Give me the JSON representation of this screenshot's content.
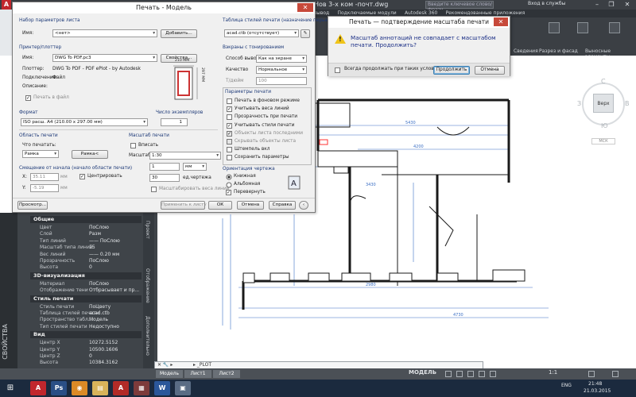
{
  "acad": {
    "title": "Нов 3-х ком -почт.dwg",
    "search_placeholder": "Введите ключевое слово/фразу",
    "login": "Вход в службы",
    "logo": "A",
    "ribbon_tabs": [
      "Вывод",
      "Подключаемые модули",
      "Autodesk 360",
      "Рекомендованные приложения"
    ],
    "ribbon_labels": [
      "Сведения",
      "Разрез и фасад",
      "Выносные элементы"
    ],
    "viewcube": {
      "face": "Верх",
      "n": "С",
      "s": "Ю",
      "w": "З",
      "e": "В",
      "mck": "МСК"
    },
    "window_controls": [
      "–",
      "❐",
      "✕"
    ]
  },
  "plot_dialog": {
    "title": "Печать - Модель",
    "close": "✕",
    "page_setup": {
      "group": "Набор параметров листа",
      "name_label": "Имя:",
      "name_value": "<нет>",
      "add_button": "Добавить..."
    },
    "printer": {
      "group": "Принтер/плоттер",
      "name_label": "Имя:",
      "name_value": "DWG To PDF.pc3",
      "props_button": "Свойства...",
      "plotter_label": "Плоттер:",
      "plotter_value": "DWG To PDF - PDF ePlot - by Autodesk",
      "where_label": "Подключение:",
      "where_value": "Файл",
      "desc_label": "Описание:",
      "plot_to_file": "Печать в файл",
      "preview_width": "210 MM",
      "preview_height": "297 MM"
    },
    "paper": {
      "group": "Формат",
      "value": "ISO расш. A4 (210.00 x 297.00 мм)"
    },
    "copies": {
      "group": "Число экземпляров",
      "value": "1"
    },
    "area": {
      "group": "Область печати",
      "what_label": "Что печатать:",
      "what_value": "Рамка",
      "frame_button": "Рамка<"
    },
    "offset": {
      "group": "Смещение от начала (начало области печати)",
      "x_label": "X:",
      "x_value": "35.11",
      "x_unit": "мм",
      "y_label": "Y:",
      "y_value": "-5.19",
      "y_unit": "мм",
      "center": "Центрировать"
    },
    "scale": {
      "group": "Масштаб печати",
      "fit": "Вписать",
      "scale_label": "Масштаб:",
      "scale_value": "1:30",
      "mm_value": "1",
      "mm_unit": "мм",
      "units_value": "30",
      "units_label": "ед.чертежа",
      "lw_scale": "Масштабировать веса линий"
    },
    "style_table": {
      "group": "Таблица стилей печати (назначение перьев)",
      "value": "acad.ctb (отсутствует)"
    },
    "shaded": {
      "group": "Вэкраны с тонированием",
      "mode_label": "Способ вывода",
      "mode_value": "Как на экране",
      "quality_label": "Качество",
      "quality_value": "Нормальное",
      "dpi_label": "Т/дюйм",
      "dpi_value": "100"
    },
    "options": {
      "group": "Параметры печати",
      "items": [
        {
          "label": "Печать в фоновом режиме",
          "checked": false,
          "enabled": true
        },
        {
          "label": "Учитывать веса линий",
          "checked": true,
          "enabled": true
        },
        {
          "label": "Прозрачность при печати",
          "checked": false,
          "enabled": true
        },
        {
          "label": "Учитывать стили печати",
          "checked": true,
          "enabled": true
        },
        {
          "label": "Объекты листа последними",
          "checked": true,
          "enabled": false
        },
        {
          "label": "Скрывать объекты листа",
          "checked": false,
          "enabled": false
        },
        {
          "label": "Штемпель вкл",
          "checked": false,
          "enabled": true
        },
        {
          "label": "Сохранить параметры",
          "checked": false,
          "enabled": true
        }
      ]
    },
    "orientation": {
      "group": "Ориентация чертежа",
      "portrait": "Книжная",
      "landscape": "Альбомная",
      "upside": "Перевернуть"
    },
    "buttons": {
      "preview": "Просмотр...",
      "apply": "Применить к листу",
      "ok": "ОК",
      "cancel": "Отмена",
      "help": "Справка"
    }
  },
  "confirm_dialog": {
    "title": "Печать — подтверждение масштаба печати",
    "close": "✕",
    "message": "Масштаб аннотаций не совпадает с масштабом печати. Продолжить?",
    "dont_show": "Всегда продолжать при таких условиях",
    "continue": "Продолжить",
    "cancel": "Отмена"
  },
  "properties": {
    "strip_label": "СВОЙСТВА",
    "side_tabs": [
      "Проект",
      "Отображение",
      "Дополнительно"
    ],
    "sections": [
      {
        "title": "Общие",
        "rows": [
          [
            "Цвет",
            "ПоСлою"
          ],
          [
            "Слой",
            "Разм"
          ],
          [
            "Тип линий",
            "—— ПоСлою"
          ],
          [
            "Масштаб типа линий",
            "15"
          ],
          [
            "Вес линий",
            "—— 0.20 мм"
          ],
          [
            "Прозрачность",
            "ПоСлою"
          ],
          [
            "Высота",
            "0"
          ]
        ]
      },
      {
        "title": "3D-визуализация",
        "rows": [
          [
            "Материал",
            "ПоСлою"
          ],
          [
            "Отображение тени",
            "Отбрасывает и пр..."
          ]
        ]
      },
      {
        "title": "Стиль печати",
        "rows": [
          [
            "Стиль печати",
            "ПоЦвету"
          ],
          [
            "Таблица стилей печати",
            "acad.ctb"
          ],
          [
            "Пространство табл...",
            "Модель"
          ],
          [
            "Тип стилей печати",
            "Недоступно"
          ]
        ]
      },
      {
        "title": "Вид",
        "rows": [
          [
            "Центр X",
            "10272.5152"
          ],
          [
            "Центр Y",
            "10500.1606"
          ],
          [
            "Центр Z",
            "0"
          ],
          [
            "Высота",
            "10384.3162"
          ]
        ]
      }
    ]
  },
  "cmdline": {
    "icons": "✕ 🔧 ▸",
    "command": "▸ _PLOT"
  },
  "statusbar": {
    "tabs": [
      "Модель",
      "Лист1",
      "Лист2"
    ],
    "model": "МОДЕЛЬ",
    "scale": "1:1"
  },
  "taskbar": {
    "start": "⊞",
    "apps": [
      {
        "label": "A",
        "color": "#c1272d"
      },
      {
        "label": "Ps",
        "color": "#2a4f86"
      },
      {
        "label": "◉",
        "color": "#dc8a26"
      },
      {
        "label": "▤",
        "color": "#d8b35a"
      },
      {
        "label": "A",
        "color": "#b22b27"
      },
      {
        "label": "▦",
        "color": "#7d3b3b"
      },
      {
        "label": "W",
        "color": "#2b579a"
      },
      {
        "label": "▣",
        "color": "#5a6c84"
      }
    ],
    "lang": "ENG",
    "time": "21:48",
    "date": "21.03.2015"
  }
}
